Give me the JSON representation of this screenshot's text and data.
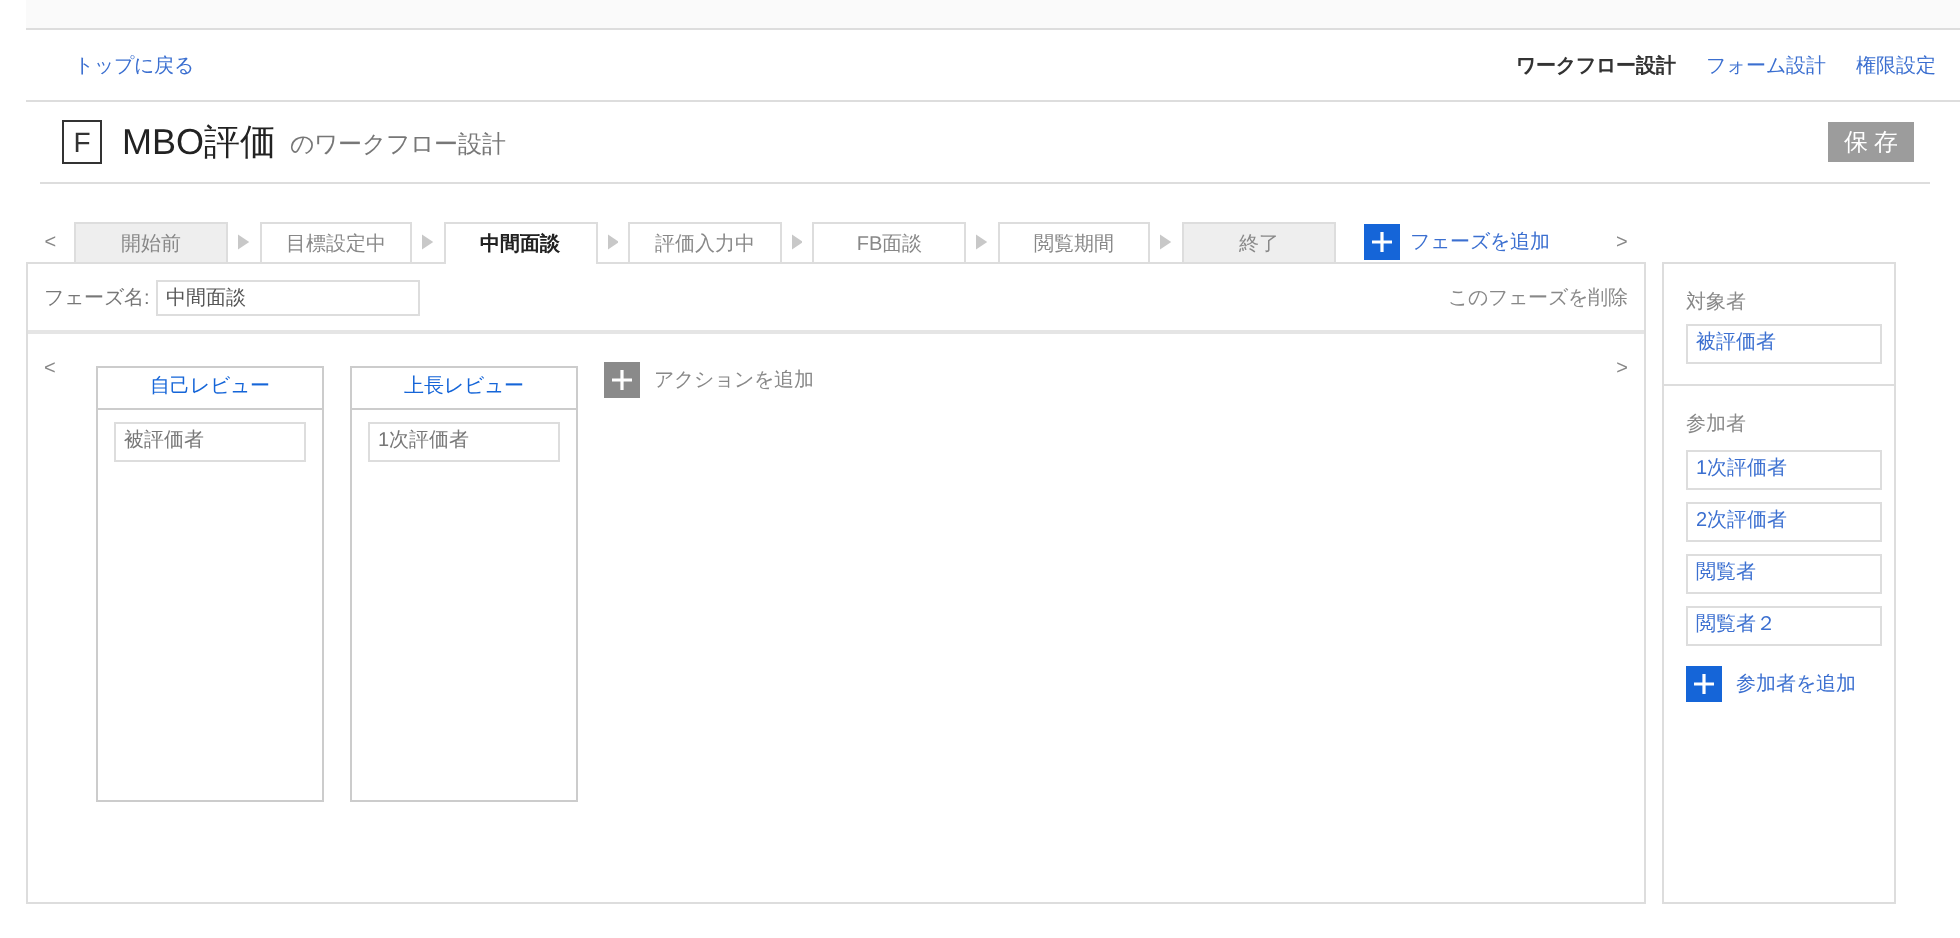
{
  "back_link": "トップに戻る",
  "nav": [
    {
      "label": "ワークフロー設計",
      "selected": true
    },
    {
      "label": "フォーム設計",
      "selected": false
    },
    {
      "label": "権限設定",
      "selected": false
    }
  ],
  "header": {
    "badge": "F",
    "title": "MBO評価",
    "subtitle": "のワークフロー設計",
    "save_button": {
      "label": "保 存",
      "disabled": true
    }
  },
  "phase_prev": "<",
  "phase_next": ">",
  "phases": [
    {
      "label": "開始前",
      "kind": "fixed",
      "selected": false
    },
    {
      "label": "目標設定中",
      "kind": "normal",
      "selected": false
    },
    {
      "label": "中間面談",
      "kind": "normal",
      "selected": true
    },
    {
      "label": "評価入力中",
      "kind": "normal",
      "selected": false
    },
    {
      "label": "FB面談",
      "kind": "normal",
      "selected": false
    },
    {
      "label": "閲覧期間",
      "kind": "normal",
      "selected": false
    },
    {
      "label": "終了",
      "kind": "fixed",
      "selected": false
    }
  ],
  "add_phase": "フェーズを追加",
  "phase_name": {
    "label": "フェーズ名:",
    "value": "中間面談"
  },
  "delete_phase": "このフェーズを削除",
  "actions_prev": "<",
  "actions_next": ">",
  "actions": [
    {
      "title": "自己レビュー",
      "assignee": "被評価者"
    },
    {
      "title": "上長レビュー",
      "assignee": "1次評価者"
    }
  ],
  "add_action": "アクションを追加",
  "sidebar": {
    "target_label": "対象者",
    "target": "被評価者",
    "participants_label": "参加者",
    "participants": [
      "1次評価者",
      "2次評価者",
      "閲覧者",
      "閲覧者２"
    ],
    "add_participant": "参加者を追加"
  }
}
